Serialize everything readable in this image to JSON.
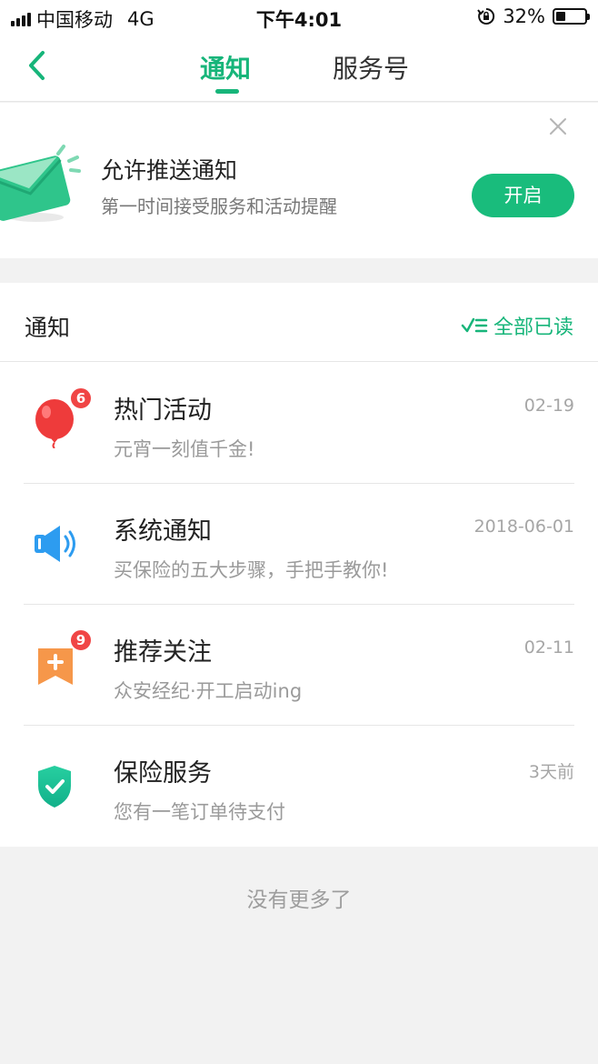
{
  "status_bar": {
    "carrier": "中国移动",
    "network": "4G",
    "time": "下午4:01",
    "battery_percent": "32%",
    "battery_level": 0.32
  },
  "nav": {
    "back_icon": "chevron-left-icon",
    "tabs": [
      {
        "label": "通知",
        "active": true
      },
      {
        "label": "服务号",
        "active": false
      }
    ]
  },
  "push_banner": {
    "title": "允许推送通知",
    "subtitle": "第一时间接受服务和活动提醒",
    "enable_label": "开启",
    "icon": "envelope-icon",
    "close_icon": "close-icon"
  },
  "notices": {
    "header": "通知",
    "mark_all_label": "全部已读",
    "items": [
      {
        "title": "热门活动",
        "subtitle": "元宵一刻值千金!",
        "time": "02-19",
        "badge": "6",
        "icon": "balloon-icon"
      },
      {
        "title": "系统通知",
        "subtitle": "买保险的五大步骤，手把手教你!",
        "time": "2018-06-01",
        "badge": "",
        "icon": "speaker-icon"
      },
      {
        "title": "推荐关注",
        "subtitle": "众安经纪·开工启动ing",
        "time": "02-11",
        "badge": "9",
        "icon": "bookmark-plus-icon"
      },
      {
        "title": "保险服务",
        "subtitle": "您有一笔订单待支付",
        "time": "3天前",
        "badge": "",
        "icon": "shield-check-icon"
      }
    ]
  },
  "footer": {
    "no_more": "没有更多了"
  },
  "colors": {
    "accent": "#17b57a",
    "badge": "#f04545"
  }
}
